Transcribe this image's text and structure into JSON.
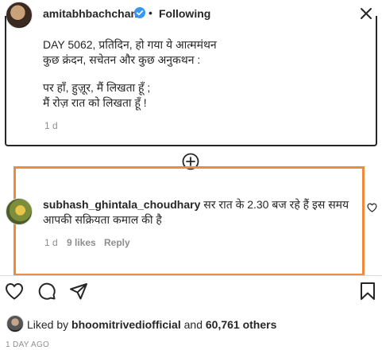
{
  "header": {
    "username": "amitabhbachchan",
    "verified_icon": "verified-badge-icon",
    "separator": "•",
    "follow_status": "Following",
    "close_icon": "close-icon"
  },
  "caption": {
    "lines": [
      "DAY 5062, प्रतिदिन, हो गया ये आत्ममंथन",
      "कुछ क्रंदन, सचेतन और कुछ अनुकथन :",
      "पर हाँ, हुज़ूर, मैं लिखता हूँ ;",
      "मैं रोज़ रात को लिखता हूँ !"
    ],
    "time": "1 d"
  },
  "load_more_icon": "plus-circle-icon",
  "comment": {
    "username": "subhash_ghintala_choudhary",
    "text_line1": "सर रात के 2.30 बज रहे हैं इस समय",
    "text_line2": "आपकी सक्रियता कमाल की है",
    "time": "1 d",
    "likes": "9 likes",
    "reply": "Reply",
    "like_icon": "heart-icon",
    "highlight_color": "#f08a3c"
  },
  "actions": {
    "like_icon": "heart-icon",
    "comment_icon": "comment-icon",
    "share_icon": "send-icon",
    "save_icon": "bookmark-icon"
  },
  "likes": {
    "prefix": "Liked by",
    "user": "bhoomitrivediofficial",
    "and": "and",
    "others": "60,761 others"
  },
  "timestamp": "1 DAY AGO"
}
